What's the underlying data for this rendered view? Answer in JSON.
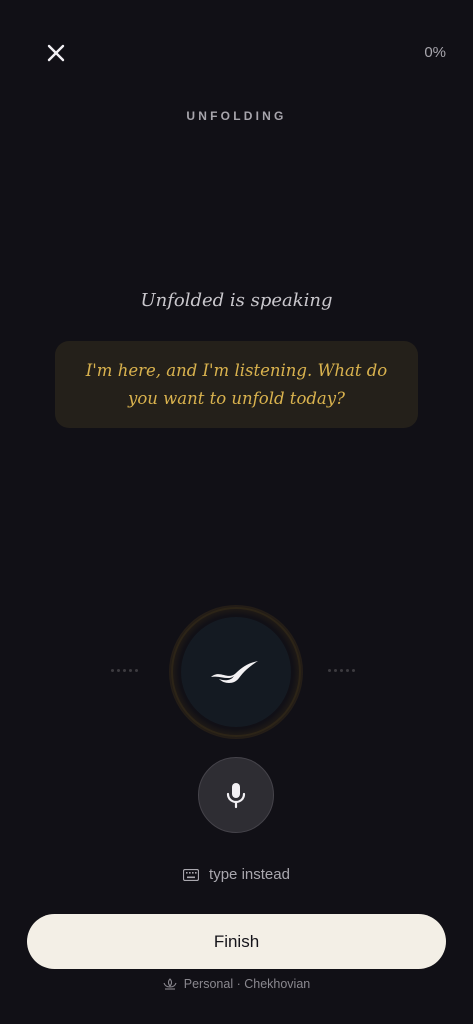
{
  "header": {
    "progress": "0%",
    "title": "UNFOLDING",
    "close_icon": "close-icon"
  },
  "conversation": {
    "speaker_status": "Unfolded is speaking",
    "message": "I'm here, and I'm listening. What do you want to unfold today?"
  },
  "controls": {
    "orb_icon": "bird-logo-icon",
    "mic_icon": "microphone-icon",
    "type_instead_label": "type instead",
    "type_instead_icon": "keyboard-icon",
    "finish_label": "Finish"
  },
  "footer": {
    "icon": "lotus-icon",
    "label": "Personal · Chekhovian"
  },
  "colors": {
    "background": "#111016",
    "accent": "#d9b24e",
    "button_bg": "#f3efe6"
  }
}
